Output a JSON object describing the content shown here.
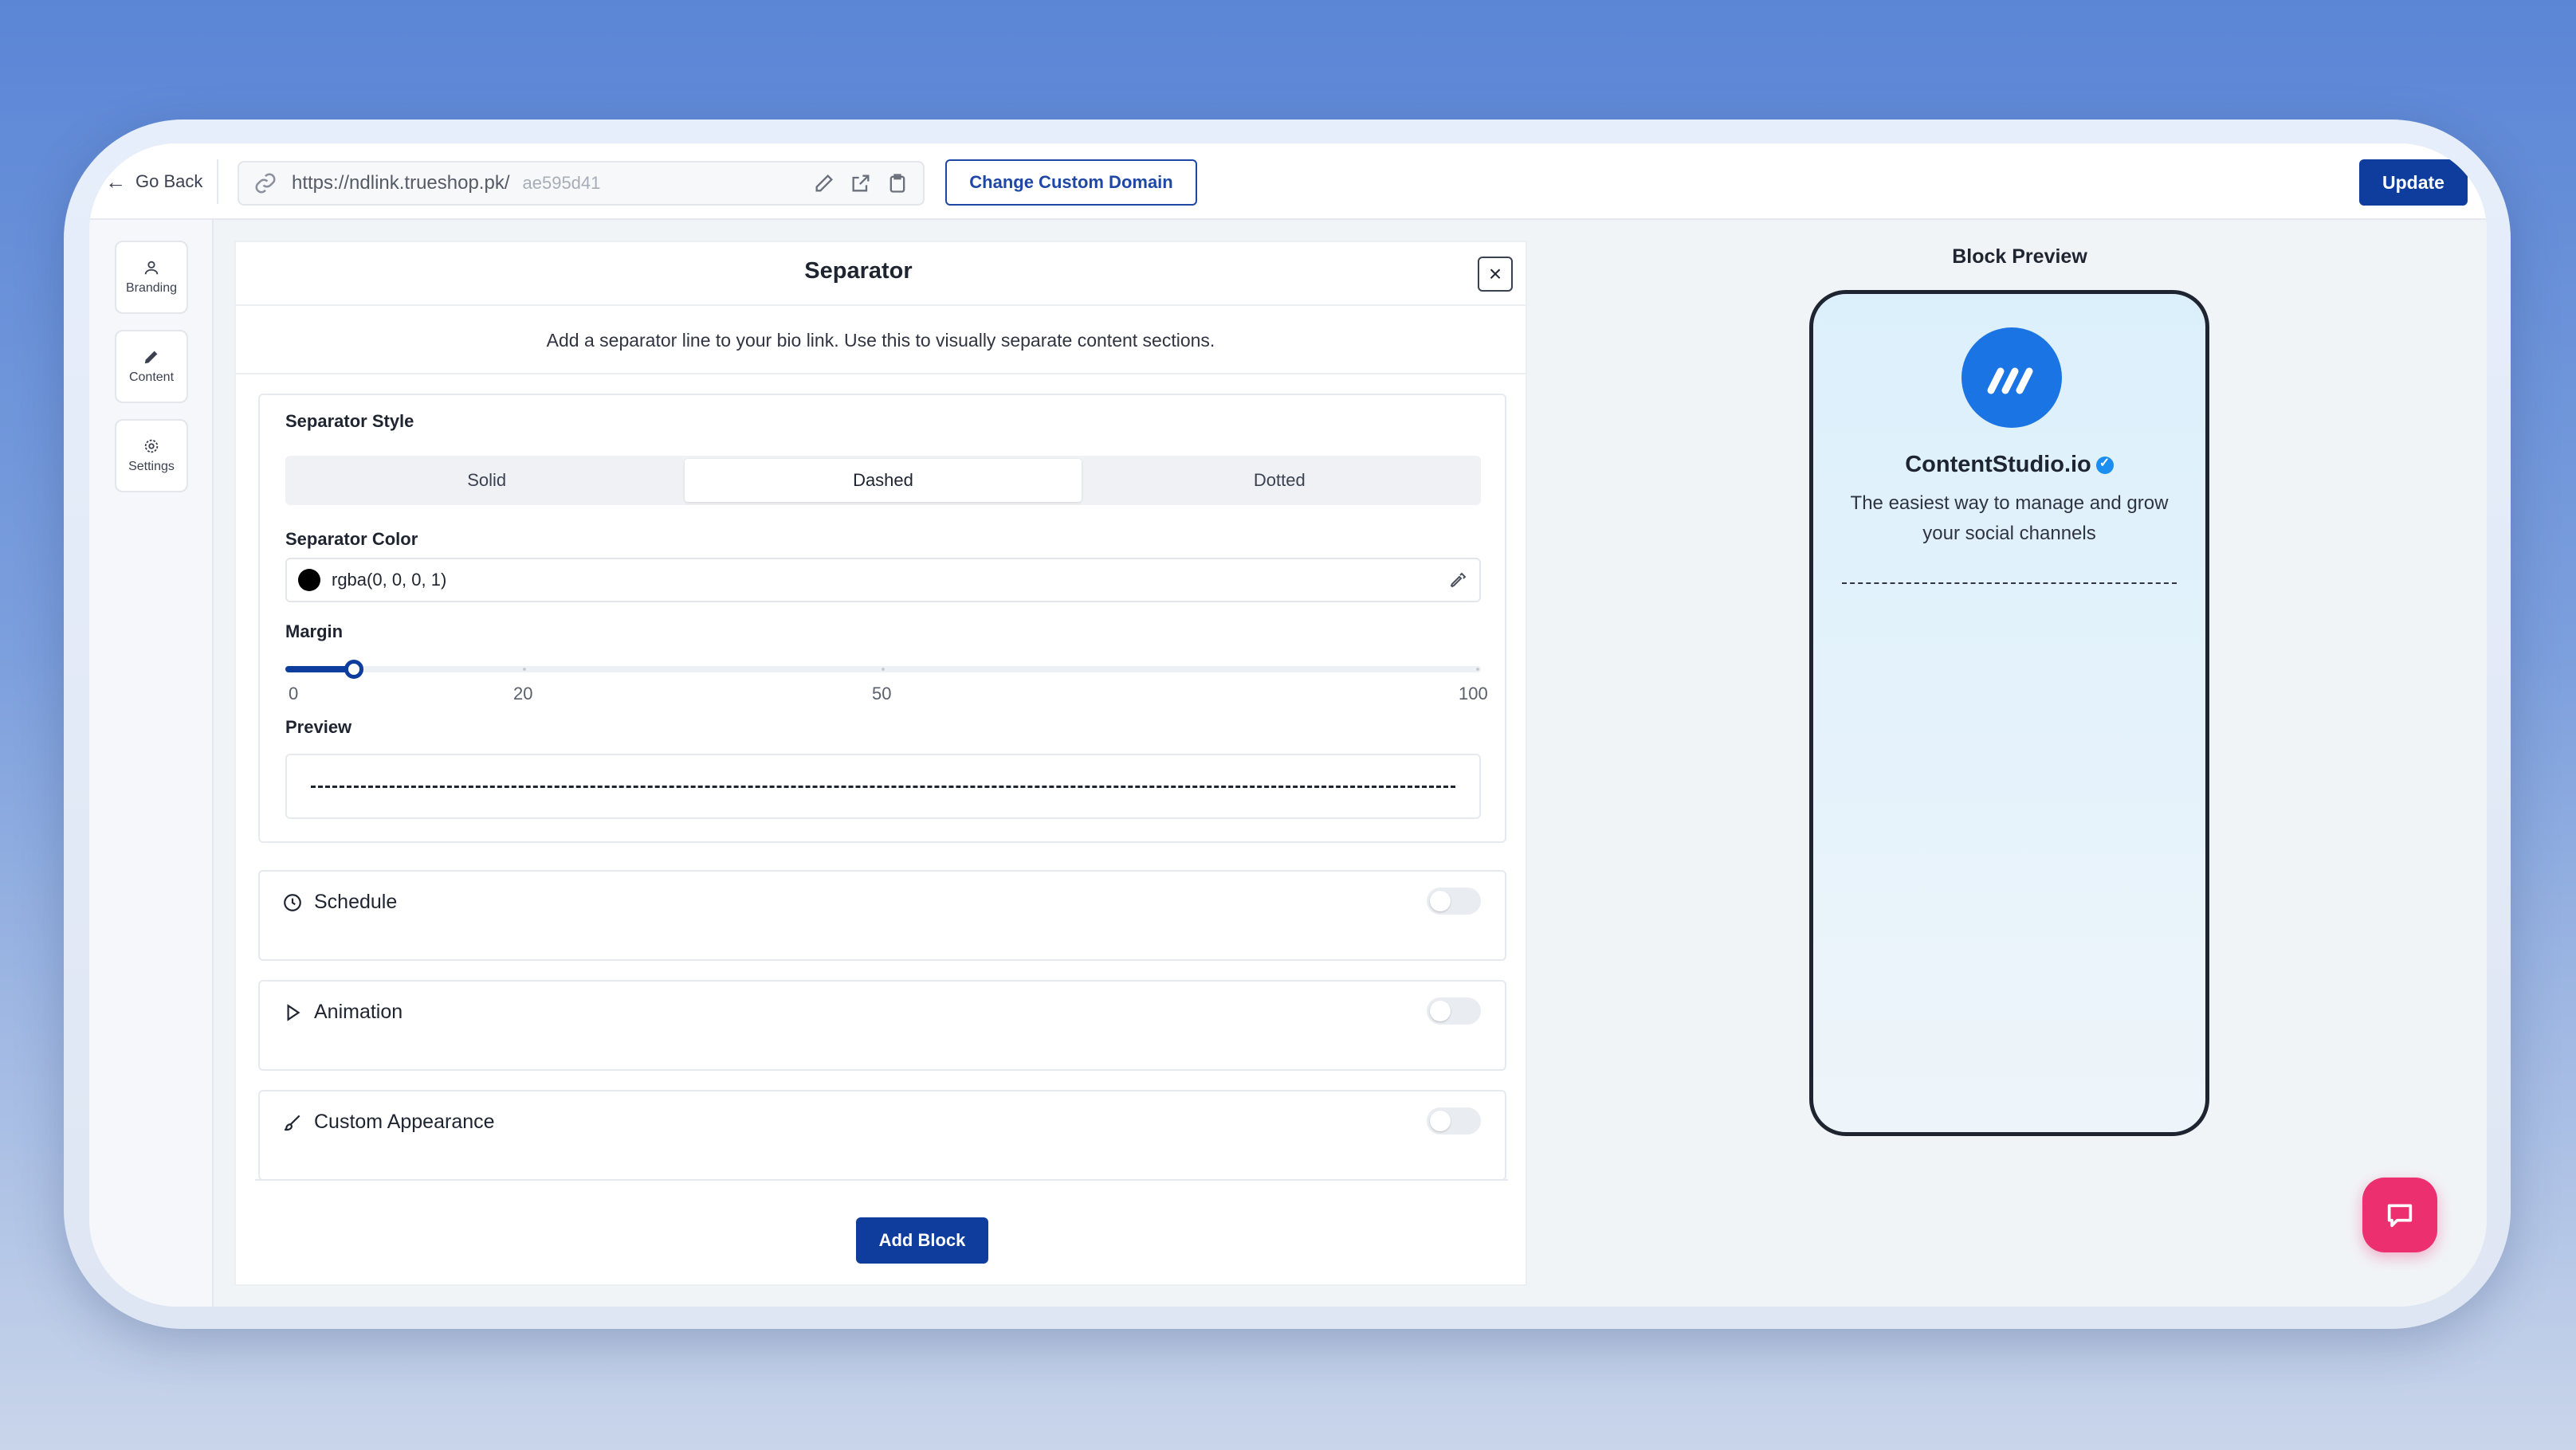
{
  "topbar": {
    "go_back": "Go Back",
    "url_base": "https://ndlink.trueshop.pk/",
    "url_slug": "ae595d41",
    "change_domain": "Change Custom Domain",
    "update": "Update"
  },
  "sidebar": {
    "items": [
      {
        "label": "Branding",
        "icon": "user-icon"
      },
      {
        "label": "Content",
        "icon": "pencil-icon"
      },
      {
        "label": "Settings",
        "icon": "gear-icon"
      }
    ]
  },
  "panel": {
    "title": "Separator",
    "description": "Add a separator line to your bio link. Use this to visually separate content sections.",
    "style_label": "Separator Style",
    "styles": [
      "Solid",
      "Dashed",
      "Dotted"
    ],
    "selected_style": "Dashed",
    "color_label": "Separator Color",
    "color_value": "rgba(0, 0, 0, 1)",
    "margin_label": "Margin",
    "margin_value": 10,
    "margin_ticks": [
      "0",
      "20",
      "50",
      "100"
    ],
    "preview_label": "Preview",
    "sections": [
      {
        "label": "Schedule",
        "icon": "clock-icon",
        "enabled": false
      },
      {
        "label": "Animation",
        "icon": "play-icon",
        "enabled": false
      },
      {
        "label": "Custom Appearance",
        "icon": "brush-icon",
        "enabled": false
      }
    ],
    "add_block": "Add Block"
  },
  "block_preview": {
    "title": "Block Preview",
    "profile_name": "ContentStudio.io",
    "bio": "The easiest way to manage and grow your social channels"
  },
  "colors": {
    "primary": "#0f3d9e",
    "brand_logo": "#1b74e4",
    "chat": "#ec2f6f"
  }
}
